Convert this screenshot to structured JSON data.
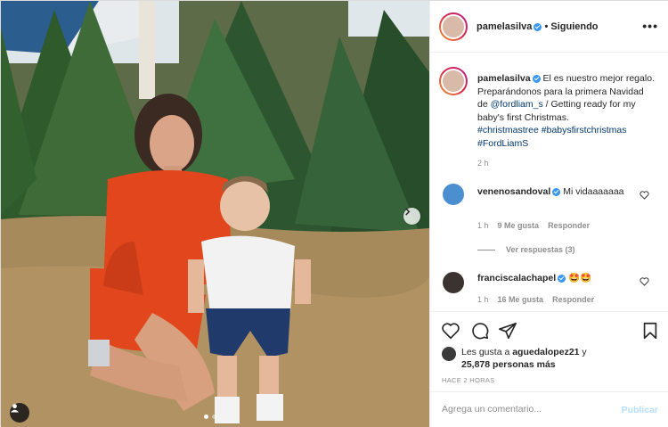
{
  "post": {
    "author": "pamelasilva",
    "separator": "•",
    "follow_status": "Siguiendo",
    "more_icon": "more-horizontal-icon",
    "caption": {
      "text_1": "El es nuestro mejor regalo. Preparándonos para la primera Navidad de",
      "mention": "@fordliam_s",
      "text_2": "/ Getting ready for my baby's first Christmas.",
      "hashtags": [
        "#christmastree",
        "#babysfirstchristmas",
        "#FordLiamS"
      ],
      "time": "2 h"
    },
    "comments": [
      {
        "user": "venenosandoval",
        "text": "Mi vidaaaaaaa",
        "time": "1 h",
        "likes": "9 Me gusta",
        "reply": "Responder",
        "view_replies": "Ver respuestas (3)"
      },
      {
        "user": "franciscalachapel",
        "text": "🤩🤩",
        "time": "1 h",
        "likes": "16 Me gusta",
        "reply": "Responder"
      }
    ],
    "likes": {
      "prefix": "Les gusta a",
      "first_liker": "aguedalopez21",
      "connector": "y",
      "count": "25,878 personas más"
    },
    "time_ago": "HACE 2 HORAS",
    "comment_placeholder": "Agrega un comentario...",
    "publish_label": "Publicar"
  },
  "carousel": {
    "current": 1,
    "total": 2
  },
  "colors": {
    "accent": "#3897f0",
    "link": "#00376b",
    "muted": "#8e8e8e",
    "publish_disabled": "#b2dffc"
  }
}
